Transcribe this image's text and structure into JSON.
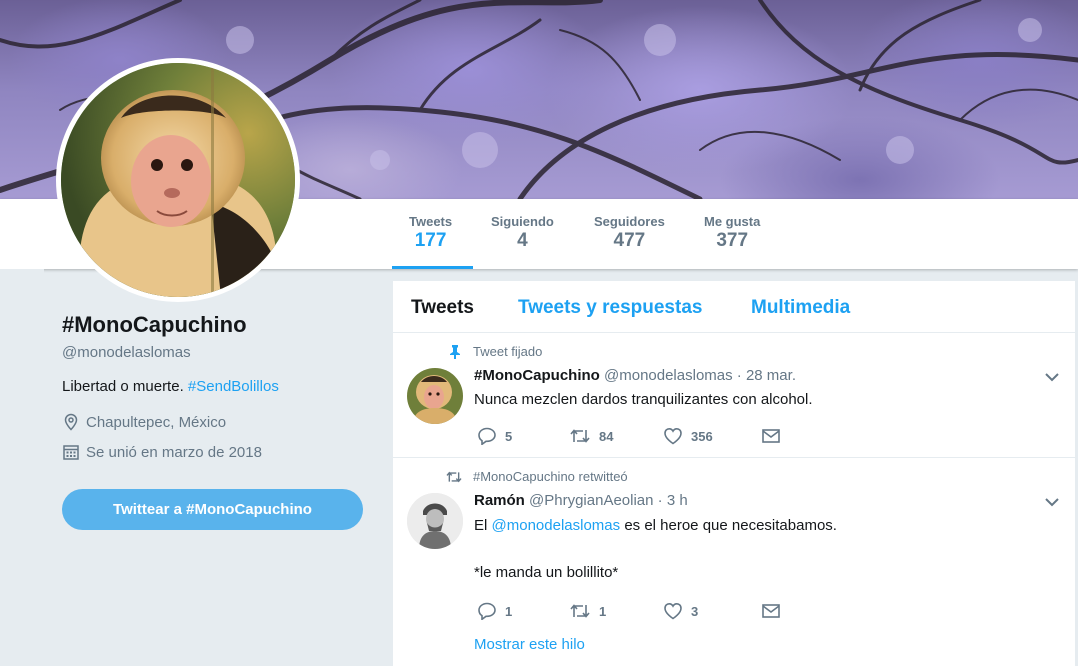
{
  "profile": {
    "name": "#MonoCapuchino",
    "handle": "@monodelaslomas",
    "bio_text": "Libertad o muerte.",
    "bio_hashtag": "#SendBolillos",
    "location": "Chapultepec, México",
    "joined": "Se unió en marzo de 2018",
    "tweet_to_button": "Twittear a #MonoCapuchino"
  },
  "stats": {
    "tweets": {
      "label": "Tweets",
      "value": "177"
    },
    "following": {
      "label": "Siguiendo",
      "value": "4"
    },
    "followers": {
      "label": "Seguidores",
      "value": "477"
    },
    "likes": {
      "label": "Me gusta",
      "value": "377"
    }
  },
  "tabs": {
    "tweets": "Tweets",
    "replies": "Tweets y respuestas",
    "media": "Multimedia"
  },
  "tweets": [
    {
      "context": "Tweet fijado",
      "name": "#MonoCapuchino",
      "handle": "@monodelaslomas",
      "time": "· 28 mar.",
      "text": "Nunca mezclen dardos tranquilizantes con alcohol.",
      "replies": "5",
      "retweets": "84",
      "likes": "356"
    },
    {
      "context": "#MonoCapuchino retwitteó",
      "name": "Ramón",
      "handle": "@PhrygianAeolian",
      "time": "· 3 h",
      "text_pre": "El",
      "text_mention": "@monodelaslomas",
      "text_post": "es el heroe que necesitabamos.",
      "text_line2": "*le manda un bolillito*",
      "replies": "1",
      "retweets": "1",
      "likes": "3",
      "show_thread": "Mostrar este hilo"
    }
  ],
  "colors": {
    "accent": "#1da1f2",
    "button": "#59b3ec",
    "background": "#e6ecf0"
  }
}
